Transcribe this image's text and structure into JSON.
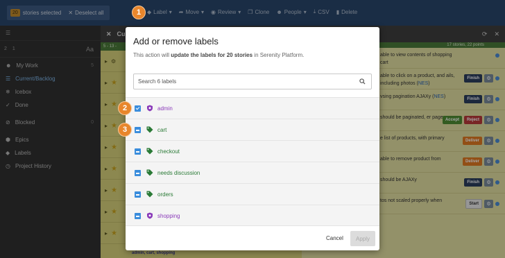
{
  "topbar": {
    "selected_count": "20",
    "selected_text": "stories selected",
    "deselect_label": "Deselect all",
    "actions": [
      {
        "label": "Label",
        "icon": "tag-icon"
      },
      {
        "label": "Move",
        "icon": "share-icon"
      },
      {
        "label": "Review",
        "icon": "check-circle-icon"
      },
      {
        "label": "Clone",
        "icon": "copy-icon"
      },
      {
        "label": "People",
        "icon": "person-icon"
      },
      {
        "label": "CSV",
        "icon": "download-icon"
      },
      {
        "label": "Delete",
        "icon": "trash-icon"
      }
    ]
  },
  "sidebar": {
    "sub_left": "2",
    "sub_mid": "1",
    "sub_right": "Aa",
    "items": [
      {
        "label": "My Work",
        "count": "5"
      },
      {
        "label": "Current/Backlog",
        "count": ""
      },
      {
        "label": "Icebox",
        "count": ""
      },
      {
        "label": "Done",
        "count": ""
      },
      {
        "label": "Blocked",
        "count": "0"
      },
      {
        "label": "Epics",
        "count": ""
      },
      {
        "label": "Labels",
        "count": ""
      },
      {
        "label": "Project History",
        "count": ""
      }
    ]
  },
  "mid": {
    "title": "Cur",
    "sub": "5 - 13 -",
    "footer": "admin, cart, shopping"
  },
  "right": {
    "sub": "17 stories, 22 points",
    "rows": [
      {
        "text": "able to view contents of shopping cart",
        "link": ""
      },
      {
        "text": "able to click on a product, and ails, including photos (",
        "link": "NES",
        "close": ")"
      },
      {
        "text": "vsing pagination AJAXy (",
        "link": "NES",
        "close": ")"
      },
      {
        "text": "should be paginated, er page",
        "link": ""
      },
      {
        "text": "e list of products, with primary",
        "link": ""
      },
      {
        "text": "able to remove product from",
        "link": ""
      },
      {
        "text": "should be AJAXy",
        "link": ""
      },
      {
        "text": "tos not scaled properly when",
        "link": ""
      }
    ],
    "buttons": {
      "finish": "Finish",
      "accept": "Accept",
      "reject": "Reject",
      "deliver": "Deliver",
      "start": "Start"
    }
  },
  "modal": {
    "title": "Add or remove labels",
    "desc_prefix": "This action will",
    "desc_bold": "update the labels for 20 stories",
    "desc_suffix": "in Serenity Platform.",
    "search_placeholder": "Search 6 labels",
    "labels": [
      {
        "name": "admin",
        "state": "checked",
        "kind": "epic"
      },
      {
        "name": "cart",
        "state": "partial",
        "kind": "tag"
      },
      {
        "name": "checkout",
        "state": "partial",
        "kind": "tag"
      },
      {
        "name": "needs discussion",
        "state": "partial",
        "kind": "tag"
      },
      {
        "name": "orders",
        "state": "partial",
        "kind": "tag"
      },
      {
        "name": "shopping",
        "state": "partial",
        "kind": "epic"
      }
    ],
    "cancel_label": "Cancel",
    "apply_label": "Apply"
  },
  "badges": [
    "1",
    "2",
    "3"
  ],
  "colors": {
    "topbar": "#29466b",
    "accent_checkbox": "#3a8ddc",
    "epic_label": "#8a3ab9",
    "tag_label": "#2a7a36",
    "badge": "#e8862c"
  }
}
